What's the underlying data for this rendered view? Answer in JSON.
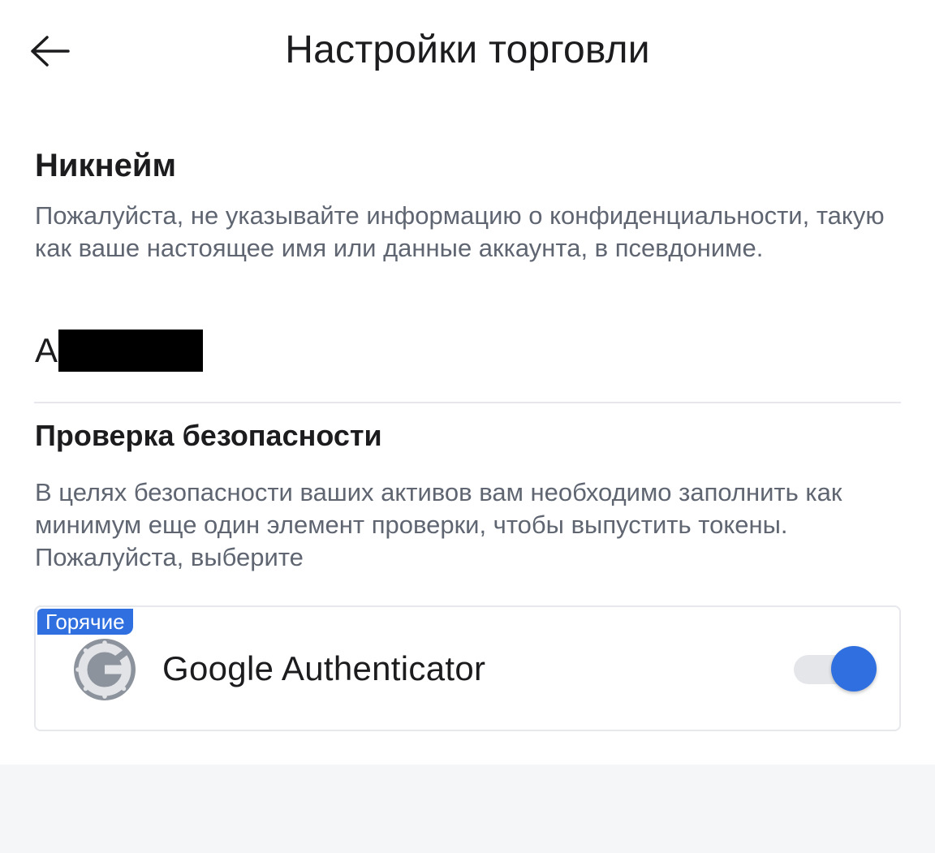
{
  "header": {
    "title": "Настройки торговли",
    "back_icon": "arrow-left-icon"
  },
  "nickname": {
    "title": "Никнейм",
    "description": "Пожалуйста, не указывайте информацию о конфиденциальности, такую как ваше настоящее имя или данные аккаунта, в псевдониме.",
    "value_visible": "A"
  },
  "security": {
    "title": "Проверка безопасности",
    "description": "В целях безопасности ваших активов вам необходимо заполнить как минимум еще один элемент проверки, чтобы выпустить токены. Пожалуйста, выберите",
    "methods": [
      {
        "badge": "Горячие",
        "label": "Google Authenticator",
        "icon": "google-authenticator-icon",
        "enabled": true
      }
    ]
  },
  "colors": {
    "accent": "#2f6fdf",
    "text_primary": "#1c1c1e",
    "text_secondary": "#5f6672",
    "divider": "#e6e8ec"
  }
}
